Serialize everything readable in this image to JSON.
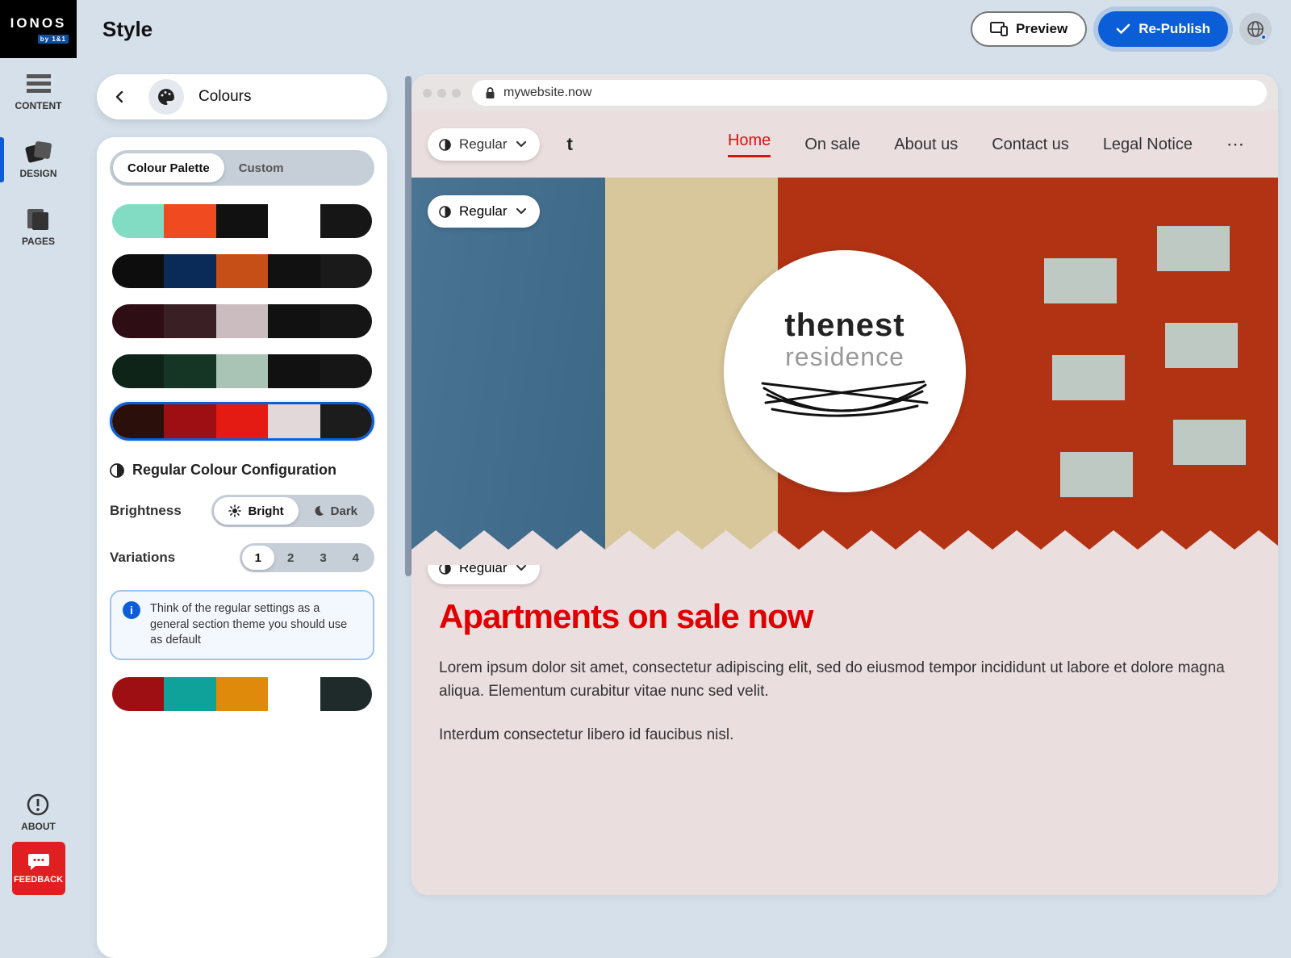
{
  "brand": "IONOS",
  "brand_sub": "by 1&1",
  "rail": {
    "content": "CONTENT",
    "design": "DESIGN",
    "pages": "PAGES",
    "about": "ABOUT",
    "feedback": "FEEDBACK"
  },
  "page_title": "Style",
  "topbar": {
    "preview": "Preview",
    "republish": "Re-Publish"
  },
  "crumb": {
    "title": "Colours"
  },
  "tabs": {
    "palette": "Colour Palette",
    "custom": "Custom"
  },
  "palettes": [
    [
      "#82dcc3",
      "#f04a20",
      "#111111",
      "#ffffff",
      "#161616"
    ],
    [
      "#0d0d0d",
      "#0a2a58",
      "#c54f16",
      "#111111",
      "#1a1a1a"
    ],
    [
      "#2e0d14",
      "#3a1f25",
      "#cbbcbf",
      "#111111",
      "#151515"
    ],
    [
      "#0f2418",
      "#153625",
      "#a9c3b5",
      "#111111",
      "#161616"
    ],
    [
      "#2a0f0a",
      "#9e0f14",
      "#e31b12",
      "#e2d8da",
      "#1c1c1c"
    ]
  ],
  "selected_palette_index": 4,
  "config_heading": "Regular Colour Configuration",
  "brightness": {
    "label": "Brightness",
    "bright": "Bright",
    "dark": "Dark"
  },
  "variations": {
    "label": "Variations",
    "options": [
      "1",
      "2",
      "3",
      "4"
    ]
  },
  "info_text": "Think of the regular settings as a general section theme you should use as default",
  "extra_palette": [
    "#9e0f14",
    "#0ea29a",
    "#e08a0c",
    "#ffffff",
    "#1f2a2a"
  ],
  "preview_url": "mywebsite.now",
  "regular_label": "Regular",
  "site": {
    "nav": {
      "home": "Home",
      "onsale": "On sale",
      "about": "About us",
      "contact": "Contact us",
      "legal": "Legal Notice"
    },
    "logo_t1": "thenest",
    "logo_t2": "residence",
    "headline": "Apartments on sale now",
    "para1": "Lorem ipsum dolor sit amet, consectetur adipiscing elit, sed do eiusmod tempor incididunt ut labore et dolore magna aliqua. Elementum curabitur vitae nunc sed velit.",
    "para2": "Interdum consectetur libero id faucibus nisl."
  }
}
